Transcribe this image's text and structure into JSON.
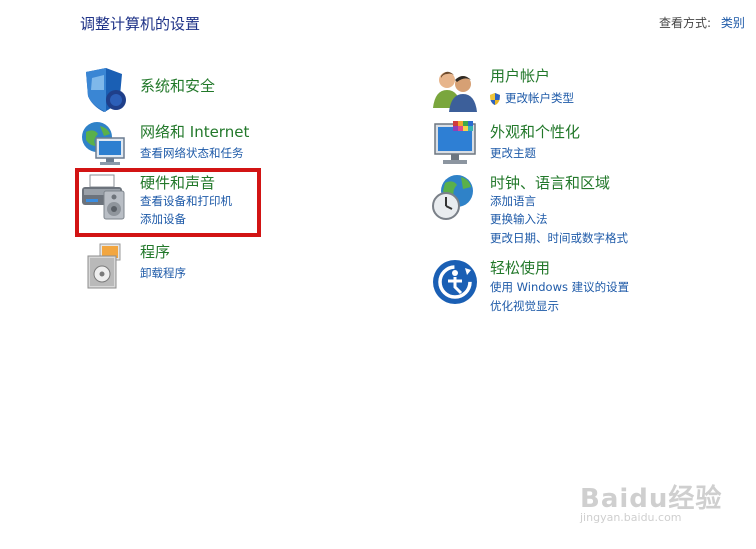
{
  "page": {
    "title": "调整计算机的设置",
    "view_by_label": "查看方式:",
    "view_by_value": "类别"
  },
  "categories_left": [
    {
      "title": "系统和安全",
      "icon": "shield-icon",
      "links": []
    },
    {
      "title": "网络和 Internet",
      "icon": "network-icon",
      "links": [
        "查看网络状态和任务"
      ]
    },
    {
      "title": "硬件和声音",
      "icon": "printer-speaker-icon",
      "links": [
        "查看设备和打印机",
        "添加设备"
      ]
    },
    {
      "title": "程序",
      "icon": "programs-icon",
      "links": [
        "卸载程序"
      ]
    }
  ],
  "categories_right": [
    {
      "title": "用户帐户",
      "icon": "users-icon",
      "links": [
        "更改帐户类型"
      ]
    },
    {
      "title": "外观和个性化",
      "icon": "monitor-icon",
      "links": [
        "更改主题"
      ]
    },
    {
      "title": "时钟、语言和区域",
      "icon": "clock-globe-icon",
      "links": [
        "添加语言",
        "更换输入法",
        "更改日期、时间或数字格式"
      ]
    },
    {
      "title": "轻松使用",
      "icon": "ease-of-access-icon",
      "links": [
        "使用 Windows 建议的设置",
        "优化视觉显示"
      ]
    }
  ],
  "annotation": {
    "color": "#d21414"
  },
  "watermark": {
    "brand": "Baidu经验",
    "sub": "jingyan.baidu.com"
  }
}
